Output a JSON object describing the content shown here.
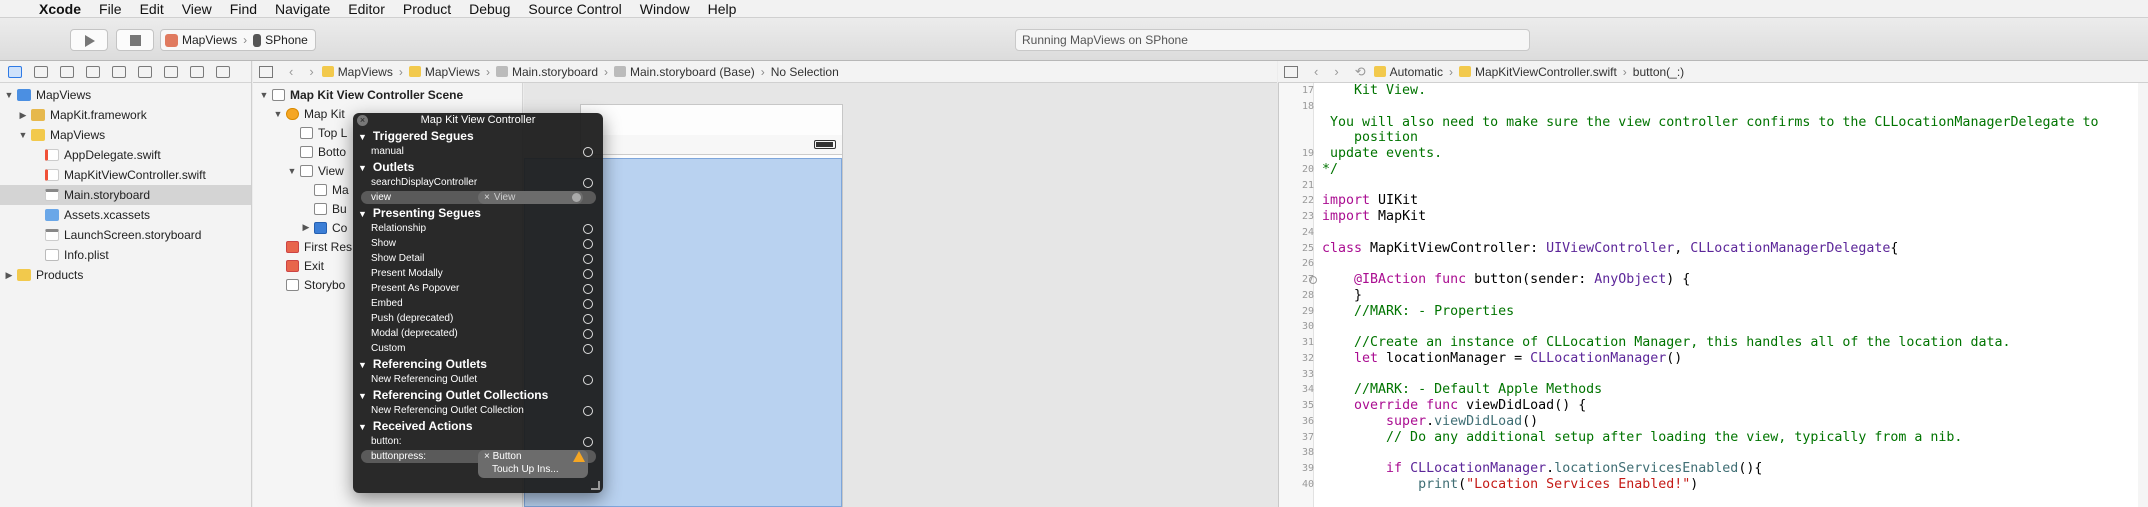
{
  "menubar": {
    "app": "Xcode",
    "items": [
      "File",
      "Edit",
      "View",
      "Find",
      "Navigate",
      "Editor",
      "Product",
      "Debug",
      "Source Control",
      "Window",
      "Help"
    ]
  },
  "toolbar": {
    "scheme": "MapViews",
    "device": "SPhone",
    "activity": "Running MapViews on SPhone"
  },
  "navigator": {
    "items": [
      {
        "label": "MapViews",
        "kind": "proj",
        "indent": 0,
        "tri": "▼"
      },
      {
        "label": "MapKit.framework",
        "kind": "fw",
        "indent": 1,
        "tri": "▶"
      },
      {
        "label": "MapViews",
        "kind": "folder",
        "indent": 1,
        "tri": "▼"
      },
      {
        "label": "AppDelegate.swift",
        "kind": "swift",
        "indent": 2,
        "tri": ""
      },
      {
        "label": "MapKitViewController.swift",
        "kind": "swift",
        "indent": 2,
        "tri": ""
      },
      {
        "label": "Main.storyboard",
        "kind": "sb",
        "indent": 2,
        "tri": "",
        "selected": true
      },
      {
        "label": "Assets.xcassets",
        "kind": "assets",
        "indent": 2,
        "tri": ""
      },
      {
        "label": "LaunchScreen.storyboard",
        "kind": "sb",
        "indent": 2,
        "tri": ""
      },
      {
        "label": "Info.plist",
        "kind": "plist",
        "indent": 2,
        "tri": ""
      },
      {
        "label": "Products",
        "kind": "folder",
        "indent": 0,
        "tri": "▶"
      }
    ]
  },
  "jumpbar_left": {
    "crumbs": [
      "MapViews",
      "MapViews",
      "Main.storyboard",
      "Main.storyboard (Base)",
      "No Selection"
    ]
  },
  "jumpbar_right": {
    "crumbs": [
      "Automatic",
      "MapKitViewController.swift",
      "button(_:)"
    ]
  },
  "outline": {
    "rows": [
      {
        "label": "Map Kit View Controller Scene",
        "indent": 0,
        "tri": "▼",
        "icon": "plain",
        "bold": true
      },
      {
        "label": "Map Kit",
        "indent": 1,
        "tri": "▼",
        "icon": "vc"
      },
      {
        "label": "Top L",
        "indent": 2,
        "tri": "",
        "icon": "plain"
      },
      {
        "label": "Botto",
        "indent": 2,
        "tri": "",
        "icon": "plain"
      },
      {
        "label": "View",
        "indent": 2,
        "tri": "▼",
        "icon": "plain"
      },
      {
        "label": "Ma",
        "indent": 3,
        "tri": "",
        "icon": "plain"
      },
      {
        "label": "Bu",
        "indent": 3,
        "tri": "",
        "icon": "plain"
      },
      {
        "label": "Co",
        "indent": 3,
        "tri": "▶",
        "icon": "blue"
      },
      {
        "label": "First Res",
        "indent": 1,
        "tri": "",
        "icon": "red"
      },
      {
        "label": "Exit",
        "indent": 1,
        "tri": "",
        "icon": "red"
      },
      {
        "label": "Storybo",
        "indent": 1,
        "tri": "",
        "icon": "plain"
      }
    ]
  },
  "popup": {
    "title": "Map Kit View Controller",
    "sections": [
      {
        "title": "Triggered Segues",
        "rows": [
          {
            "label": "manual"
          }
        ]
      },
      {
        "title": "Outlets",
        "rows": [
          {
            "label": "searchDisplayController"
          },
          {
            "label": "view",
            "connection": "View",
            "highlight": true
          }
        ]
      },
      {
        "title": "Presenting Segues",
        "rows": [
          {
            "label": "Relationship"
          },
          {
            "label": "Show"
          },
          {
            "label": "Show Detail"
          },
          {
            "label": "Present Modally"
          },
          {
            "label": "Present As Popover"
          },
          {
            "label": "Embed"
          },
          {
            "label": "Push (deprecated)"
          },
          {
            "label": "Modal (deprecated)"
          },
          {
            "label": "Custom"
          }
        ]
      },
      {
        "title": "Referencing Outlets",
        "rows": [
          {
            "label": "New Referencing Outlet"
          }
        ]
      },
      {
        "title": "Referencing Outlet Collections",
        "rows": [
          {
            "label": "New Referencing Outlet Collection"
          }
        ]
      },
      {
        "title": "Received Actions",
        "rows": [
          {
            "label": "button:"
          },
          {
            "label": "buttonpress:",
            "action": "Button",
            "action_event": "Touch Up Ins...",
            "highlight": true,
            "warning": true
          }
        ]
      }
    ]
  },
  "code": {
    "lines": [
      {
        "n": "17",
        "html": "<span class=\"cm\">    Kit View.</span>"
      },
      {
        "n": "18",
        "html": ""
      },
      {
        "n": "",
        "html": "<span class=\"cm\"> You will also need to make sure the view controller confirms to the CLLocationManagerDelegate to</span>"
      },
      {
        "n": "",
        "html": "<span class=\"cm\">    position</span>"
      },
      {
        "n": "19",
        "html": "<span class=\"cm\"> update events.</span>"
      },
      {
        "n": "20",
        "html": "<span class=\"cm\">*/</span>"
      },
      {
        "n": "21",
        "html": ""
      },
      {
        "n": "22",
        "html": "<span class=\"kw\">import</span> UIKit"
      },
      {
        "n": "23",
        "html": "<span class=\"kw\">import</span> MapKit"
      },
      {
        "n": "24",
        "html": ""
      },
      {
        "n": "25",
        "html": "<span class=\"kw\">class</span> MapKitViewController: <span class=\"ty\">UIViewController</span>, <span class=\"ty\">CLLocationManagerDelegate</span>{"
      },
      {
        "n": "26",
        "html": ""
      },
      {
        "n": "27",
        "html": "    <span class=\"kw\">@IBAction</span> <span class=\"kw\">func</span> button(sender: <span class=\"ty\">AnyObject</span>) {",
        "ib": true
      },
      {
        "n": "28",
        "html": "    }"
      },
      {
        "n": "29",
        "html": "<span class=\"cm\">    //MARK: - Properties</span>"
      },
      {
        "n": "30",
        "html": ""
      },
      {
        "n": "31",
        "html": "<span class=\"cm\">    //Create an instance of CLLocation Manager, this handles all of the location data.</span>"
      },
      {
        "n": "32",
        "html": "    <span class=\"kw\">let</span> locationManager = <span class=\"ty\">CLLocationManager</span>()"
      },
      {
        "n": "33",
        "html": ""
      },
      {
        "n": "34",
        "html": "<span class=\"cm\">    //MARK: - Default Apple Methods</span>"
      },
      {
        "n": "35",
        "html": "    <span class=\"kw\">override</span> <span class=\"kw\">func</span> viewDidLoad() {"
      },
      {
        "n": "36",
        "html": "        <span class=\"kw\">super</span>.<span class=\"fn\">viewDidLoad</span>()"
      },
      {
        "n": "37",
        "html": "<span class=\"cm\">        // Do any additional setup after loading the view, typically from a nib.</span>"
      },
      {
        "n": "38",
        "html": ""
      },
      {
        "n": "39",
        "html": "        <span class=\"kw\">if</span> <span class=\"ty\">CLLocationManager</span>.<span class=\"fn\">locationServicesEnabled</span>(){"
      },
      {
        "n": "40",
        "html": "            <span class=\"fn\">print</span>(<span class=\"st\">\"Location Services Enabled!\"</span>)"
      }
    ]
  }
}
